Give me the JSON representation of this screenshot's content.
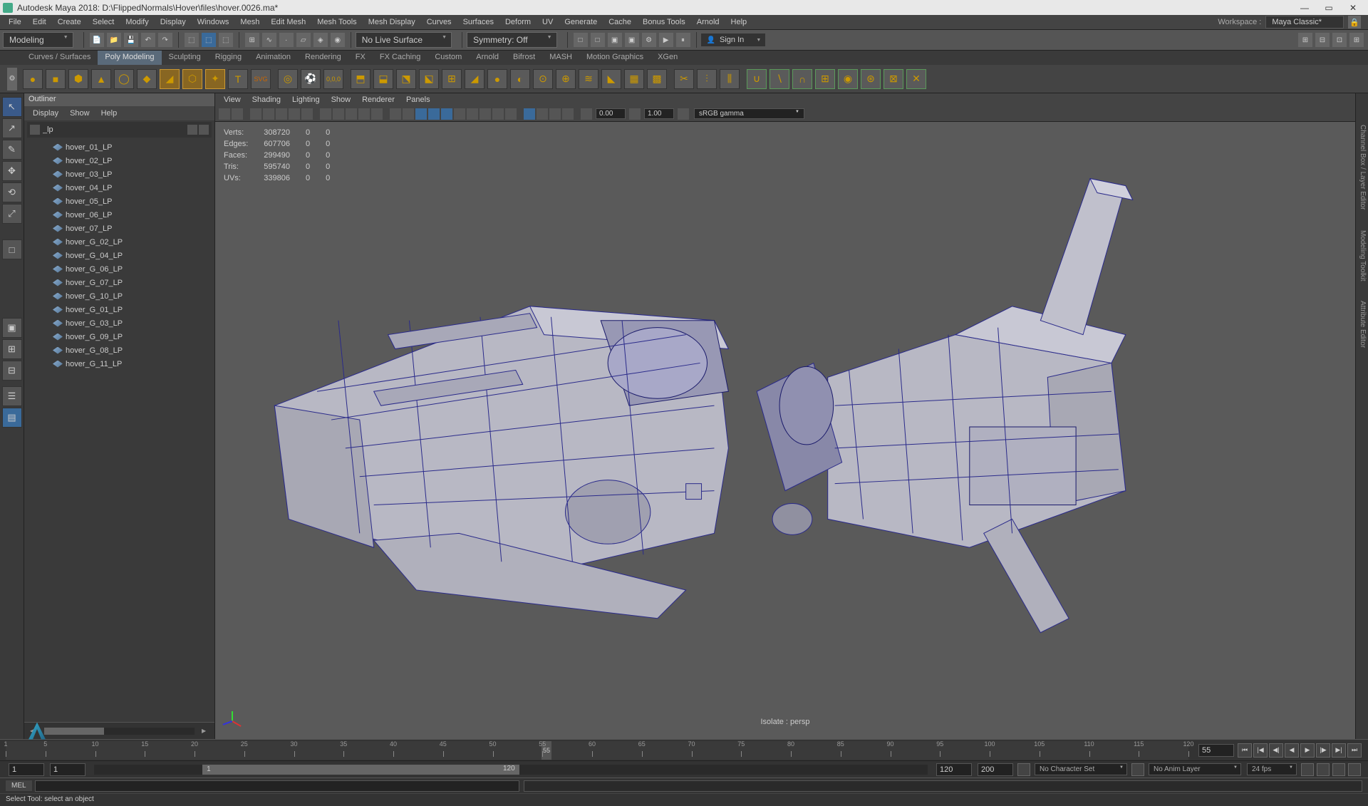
{
  "title": "Autodesk Maya 2018: D:\\FlippedNormals\\Hover\\files\\hover.0026.ma*",
  "menubar": [
    "File",
    "Edit",
    "Create",
    "Select",
    "Modify",
    "Display",
    "Windows",
    "Mesh",
    "Edit Mesh",
    "Mesh Tools",
    "Mesh Display",
    "Curves",
    "Surfaces",
    "Deform",
    "UV",
    "Generate",
    "Cache",
    "Bonus Tools",
    "Arnold",
    "Help"
  ],
  "workspace": {
    "label": "Workspace :",
    "value": "Maya Classic*"
  },
  "statusbar": {
    "mode": "Modeling",
    "live_surface": "No Live Surface",
    "symmetry": "Symmetry: Off",
    "signin": "Sign In"
  },
  "shelf_tabs": [
    "Curves / Surfaces",
    "Poly Modeling",
    "Sculpting",
    "Rigging",
    "Animation",
    "Rendering",
    "FX",
    "FX Caching",
    "Custom",
    "Arnold",
    "Bifrost",
    "MASH",
    "Motion Graphics",
    "XGen"
  ],
  "shelf_active": 1,
  "outliner": {
    "title": "Outliner",
    "menu": [
      "Display",
      "Show",
      "Help"
    ],
    "search": "_lp",
    "items": [
      "hover_01_LP",
      "hover_02_LP",
      "hover_03_LP",
      "hover_04_LP",
      "hover_05_LP",
      "hover_06_LP",
      "hover_07_LP",
      "hover_G_02_LP",
      "hover_G_04_LP",
      "hover_G_06_LP",
      "hover_G_07_LP",
      "hover_G_10_LP",
      "hover_G_01_LP",
      "hover_G_03_LP",
      "hover_G_09_LP",
      "hover_G_08_LP",
      "hover_G_11_LP"
    ]
  },
  "viewport": {
    "menu": [
      "View",
      "Shading",
      "Lighting",
      "Show",
      "Renderer",
      "Panels"
    ],
    "gamma_field1": "0.00",
    "gamma_field2": "1.00",
    "gamma_mode": "sRGB gamma",
    "label": "Isolate : persp",
    "stats": {
      "Verts": [
        "308720",
        "0",
        "0"
      ],
      "Edges": [
        "607706",
        "0",
        "0"
      ],
      "Faces": [
        "299490",
        "0",
        "0"
      ],
      "Tris": [
        "595740",
        "0",
        "0"
      ],
      "UVs": [
        "339806",
        "0",
        "0"
      ]
    }
  },
  "right_tabs": [
    "Channel Box / Layer Editor",
    "Modeling Toolkit",
    "Attribute Editor"
  ],
  "time": {
    "ticks": [
      1,
      5,
      10,
      15,
      20,
      25,
      30,
      35,
      40,
      45,
      50,
      55,
      60,
      65,
      70,
      75,
      80,
      85,
      90,
      95,
      100,
      105,
      110,
      115,
      120
    ],
    "current": "55",
    "current_field": "55"
  },
  "range": {
    "start": "1",
    "start_inner": "1",
    "mid_value": "1",
    "end_inner": "120",
    "end": "120",
    "end2": "200",
    "char_set": "No Character Set",
    "anim_layer": "No Anim Layer",
    "fps": "24 fps"
  },
  "cmd": {
    "label": "MEL"
  },
  "help": "Select Tool: select an object"
}
